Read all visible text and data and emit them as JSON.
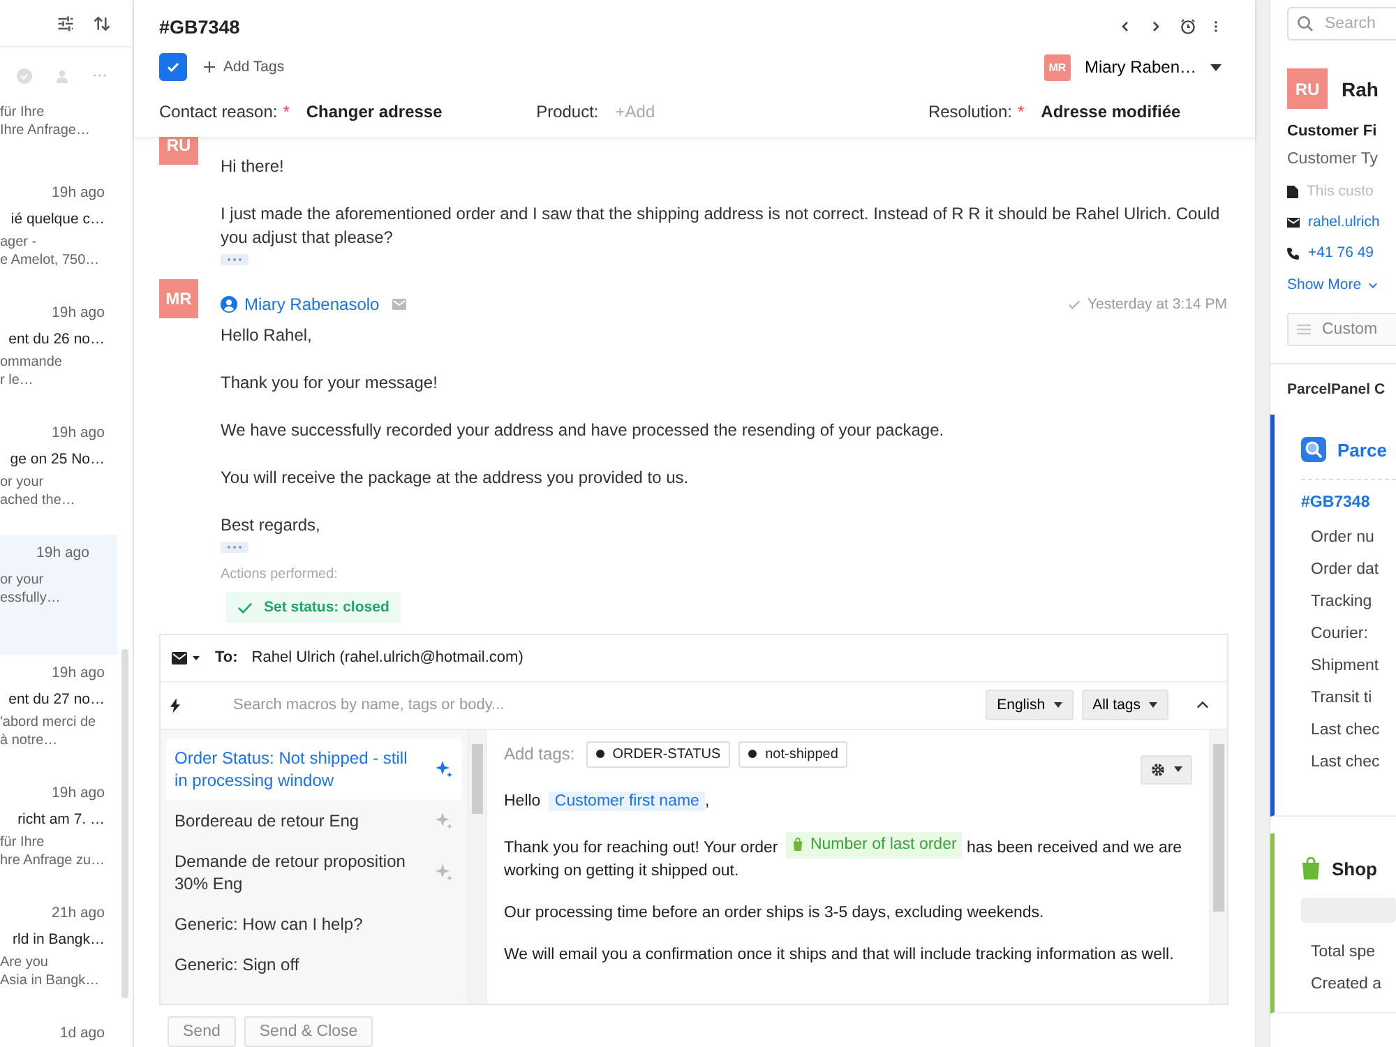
{
  "ticket_list": {
    "items": [
      {
        "preview": [
          "für Ihre",
          "Ihre Anfrage…"
        ],
        "selected": false
      },
      {
        "time": "19h ago",
        "title": "ié quelque c…",
        "preview": [
          "ager -",
          "e Amelot, 750…"
        ],
        "selected": false
      },
      {
        "time": "19h ago",
        "title": "ent du 26 no…",
        "preview": [
          "ommande",
          "r le…"
        ],
        "selected": false
      },
      {
        "time": "19h ago",
        "title": "ge on 25 No…",
        "preview": [
          "or your",
          "ached the…"
        ],
        "selected": false
      },
      {
        "time": "19h ago",
        "preview": [
          "or your",
          "essfully…"
        ],
        "selected": true
      },
      {
        "time": "19h ago",
        "title": "ent du 27 no…",
        "preview": [
          "'abord merci de",
          "à notre…"
        ],
        "selected": false
      },
      {
        "time": "19h ago",
        "title": "richt am 7. …",
        "preview": [
          "für Ihre",
          "hre Anfrage zu…"
        ],
        "selected": false
      },
      {
        "time": "21h ago",
        "title": "rld in Bangk…",
        "preview": [
          "Are you",
          "Asia in Bangk…"
        ],
        "selected": false
      },
      {
        "time": "1d ago",
        "selected": false
      }
    ]
  },
  "ticket": {
    "title": "#GB7348",
    "closed": true,
    "add_tags": "Add Tags",
    "assignee": {
      "initials": "MR",
      "name": "Miary Raben…"
    },
    "fields": [
      {
        "label": "Contact reason:",
        "required_mark": "*",
        "value": "Changer adresse"
      },
      {
        "label": "Product:",
        "placeholder": "+Add"
      },
      {
        "label": "Resolution:",
        "required_mark": "*",
        "value": "Adresse modifiée"
      }
    ]
  },
  "messages": [
    {
      "initials": "RU",
      "body": [
        "Hi there!",
        "I just made the aforementioned order and I saw that the shipping address is not correct. Instead of R R it should be Rahel Ulrich. Could you adjust that please?"
      ]
    },
    {
      "initials": "MR",
      "author": "Miary Rabenasolo",
      "time": "Yesterday at 3:14 PM",
      "body": [
        "Hello Rahel,",
        "Thank you for your message!",
        "We have successfully recorded your address and have processed the resending of your package.",
        "You will receive the package at the address you provided to us.",
        "Best regards,"
      ],
      "actions_label": "Actions performed:",
      "actions": [
        "Set status: closed"
      ]
    }
  ],
  "composer": {
    "to_label": "To:",
    "to": "Rahel Ulrich (rahel.ulrich@hotmail.com)",
    "macro_search": {
      "placeholder": "Search macros by name, tags or body..."
    },
    "language": "English",
    "tags_filter": "All tags",
    "macros": [
      {
        "name": "Order Status: Not shipped - still in processing window",
        "selected": true,
        "ai": true
      },
      {
        "name": "Bordereau de retour Eng",
        "selected": false,
        "ai": true
      },
      {
        "name": "Demande de retour proposition 30% Eng",
        "selected": false,
        "ai": true
      },
      {
        "name": "Generic: How can I help?",
        "selected": false,
        "ai": false
      },
      {
        "name": "Generic: Sign off",
        "selected": false,
        "ai": false
      }
    ],
    "add_tags_label": "Add tags:",
    "tags": [
      "ORDER-STATUS",
      "not-shipped"
    ],
    "paragraphs": [
      [
        {
          "kind": "text",
          "text": "Hello"
        },
        {
          "kind": "customer_variable",
          "text": "Customer first name"
        },
        {
          "kind": "text",
          "text": ","
        }
      ],
      [
        {
          "kind": "text",
          "text": "Thank you for reaching out!  Your order"
        },
        {
          "kind": "order_variable",
          "text": "Number of last order"
        },
        {
          "kind": "text",
          "text": "has been received and we are working on getting it shipped out."
        }
      ],
      [
        {
          "kind": "text",
          "text": "Our processing time before an order ships is 3-5 days, excluding weekends."
        }
      ],
      [
        {
          "kind": "text",
          "text": "We will email you a confirmation once it ships and that will include tracking information as well."
        }
      ]
    ],
    "buttons": [
      "Send",
      "Send & Close"
    ]
  },
  "customer_panel": {
    "search": {
      "placeholder": "Search"
    },
    "initials": "RU",
    "name": "Rah",
    "fields_title": "Customer Fi",
    "type_label": "Customer Ty",
    "note": "This custo",
    "email": "rahel.ulrich",
    "phone": "+41 76 49",
    "show_more": "Show More",
    "custom_button": "Custom",
    "integration_title": "ParcelPanel C",
    "parcel": {
      "title": "Parce",
      "order": "#GB7348",
      "rows": [
        "Order nu",
        "Order dat",
        "Tracking",
        "Courier:",
        "Shipment",
        "Transit ti",
        "Last chec",
        "Last chec"
      ]
    },
    "shop": {
      "title": "Shop",
      "rows": [
        "Total spe",
        "Created a"
      ]
    }
  }
}
